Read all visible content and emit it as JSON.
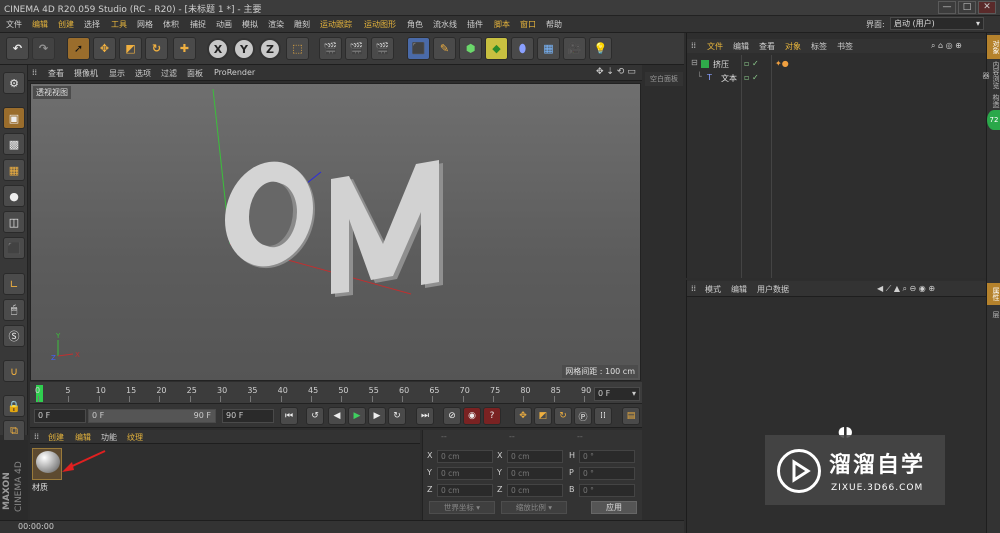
{
  "title_bar": {
    "text": "CINEMA 4D R20.059 Studio (RC - R20) - [未标题 1 *] - 主要",
    "min": "—",
    "max": "□",
    "close": "✕"
  },
  "menu": {
    "items": [
      "文件",
      "编辑",
      "创建",
      "选择",
      "工具",
      "网格",
      "体积",
      "捕捉",
      "动画",
      "模拟",
      "渲染",
      "雕刻",
      "运动跟踪",
      "运动图形",
      "角色",
      "流水线",
      "插件",
      "脚本",
      "窗口",
      "帮助"
    ],
    "layout_label": "界面:",
    "layout_value": "启动 (用户)"
  },
  "viewport": {
    "menu": [
      "查看",
      "摄像机",
      "显示",
      "选项",
      "过滤",
      "面板",
      "ProRender"
    ],
    "view_label": "透视视图",
    "grid_spacing": "网格间距 : 100 cm",
    "side_tab": "空白面板",
    "scene_text": "OM"
  },
  "timeline": {
    "ticks": [
      "0",
      "5",
      "10",
      "15",
      "20",
      "25",
      "30",
      "35",
      "40",
      "45",
      "50",
      "55",
      "60",
      "65",
      "70",
      "75",
      "80",
      "85",
      "90"
    ],
    "current_frame": "0 F"
  },
  "transport": {
    "start": "0 F",
    "range_start": "0 F",
    "range_end": "90 F",
    "end": "90 F"
  },
  "material_manager": {
    "menu": [
      "创建",
      "编辑",
      "功能",
      "纹理"
    ],
    "material_name": "材质"
  },
  "coords": {
    "headers": [
      "--",
      "--",
      "--"
    ],
    "rows": [
      {
        "a": "X",
        "av": "0 cm",
        "b": "X",
        "bv": "0 cm",
        "c": "H",
        "cv": "0 °"
      },
      {
        "a": "Y",
        "av": "0 cm",
        "b": "Y",
        "bv": "0 cm",
        "c": "P",
        "cv": "0 °"
      },
      {
        "a": "Z",
        "av": "0 cm",
        "b": "Z",
        "bv": "0 cm",
        "c": "B",
        "cv": "0 °"
      }
    ],
    "world_dropdown": "世界坐标",
    "scale_dropdown": "缩放比例",
    "apply": "应用"
  },
  "status": {
    "time": "00:00:00"
  },
  "maxon": {
    "line1": "MAXON",
    "line2": "CINEMA 4D"
  },
  "object_manager": {
    "menu": [
      "文件",
      "编辑",
      "查看",
      "对象",
      "标签",
      "书签"
    ],
    "objects": [
      {
        "name": "挤压"
      },
      {
        "name": "文本"
      }
    ]
  },
  "attribute_manager": {
    "menu": [
      "模式",
      "编辑",
      "用户数据"
    ]
  },
  "right_tabs": [
    "对象",
    "内容浏览器",
    "构造",
    "属性",
    "层"
  ],
  "badge": "72",
  "watermark": {
    "title": "溜溜自学",
    "subtitle": "ZIXUE.3D66.COM"
  }
}
